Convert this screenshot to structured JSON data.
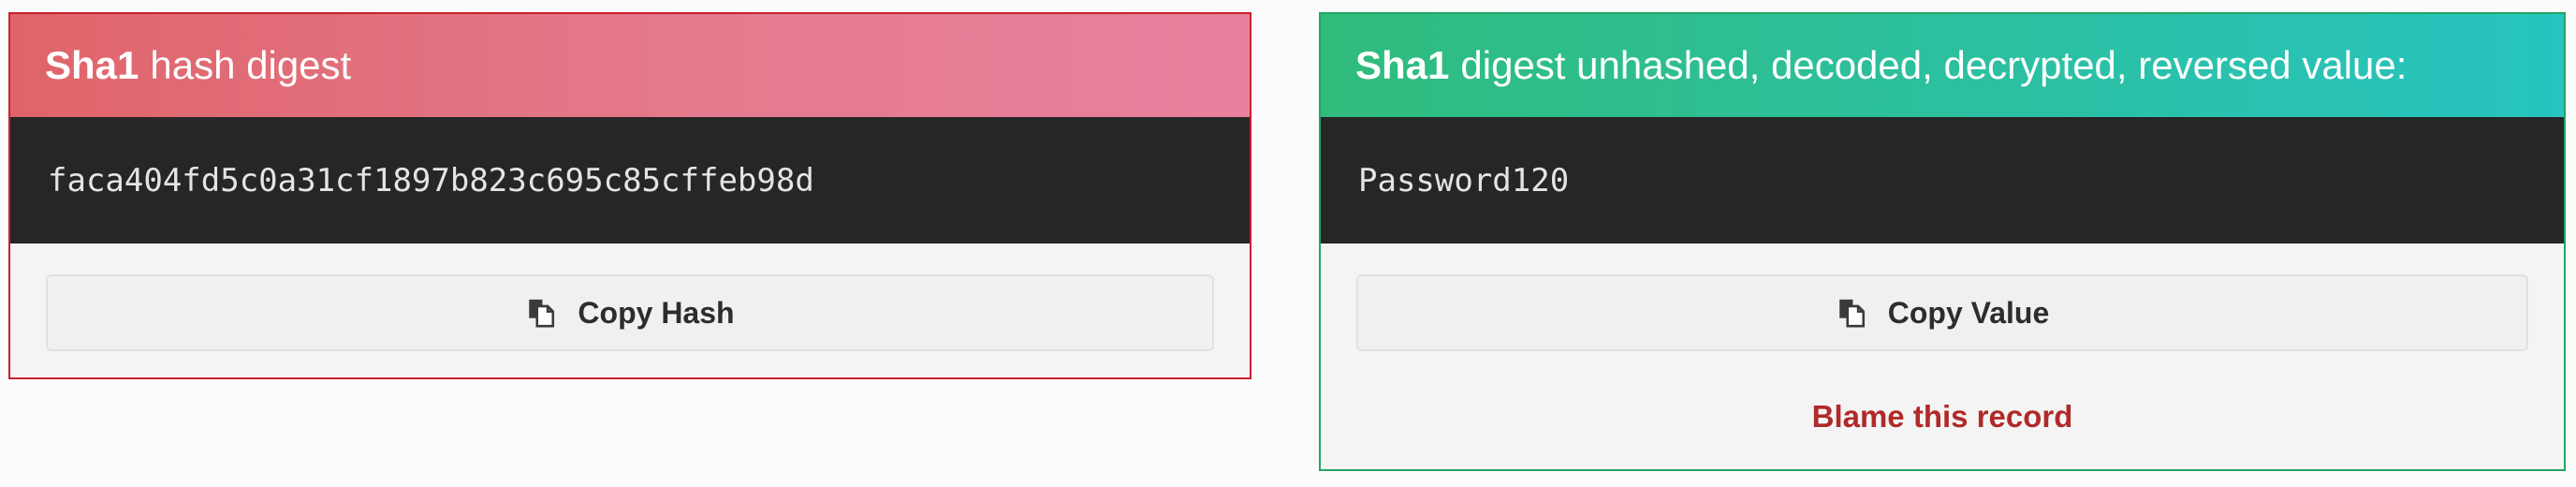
{
  "hash_card": {
    "algo": "Sha1",
    "title": "hash digest",
    "digest": "faca404fd5c0a31cf1897b823c695c85cffeb98d",
    "copy_label": "Copy Hash",
    "copy_icon": "copy-icon",
    "accent": "#c8202e"
  },
  "value_card": {
    "algo": "Sha1",
    "title": "digest unhashed, decoded, decrypted, reversed value:",
    "value": "Password120",
    "copy_label": "Copy Value",
    "copy_icon": "copy-icon",
    "blame_label": "Blame this record",
    "accent": "#22a564"
  }
}
